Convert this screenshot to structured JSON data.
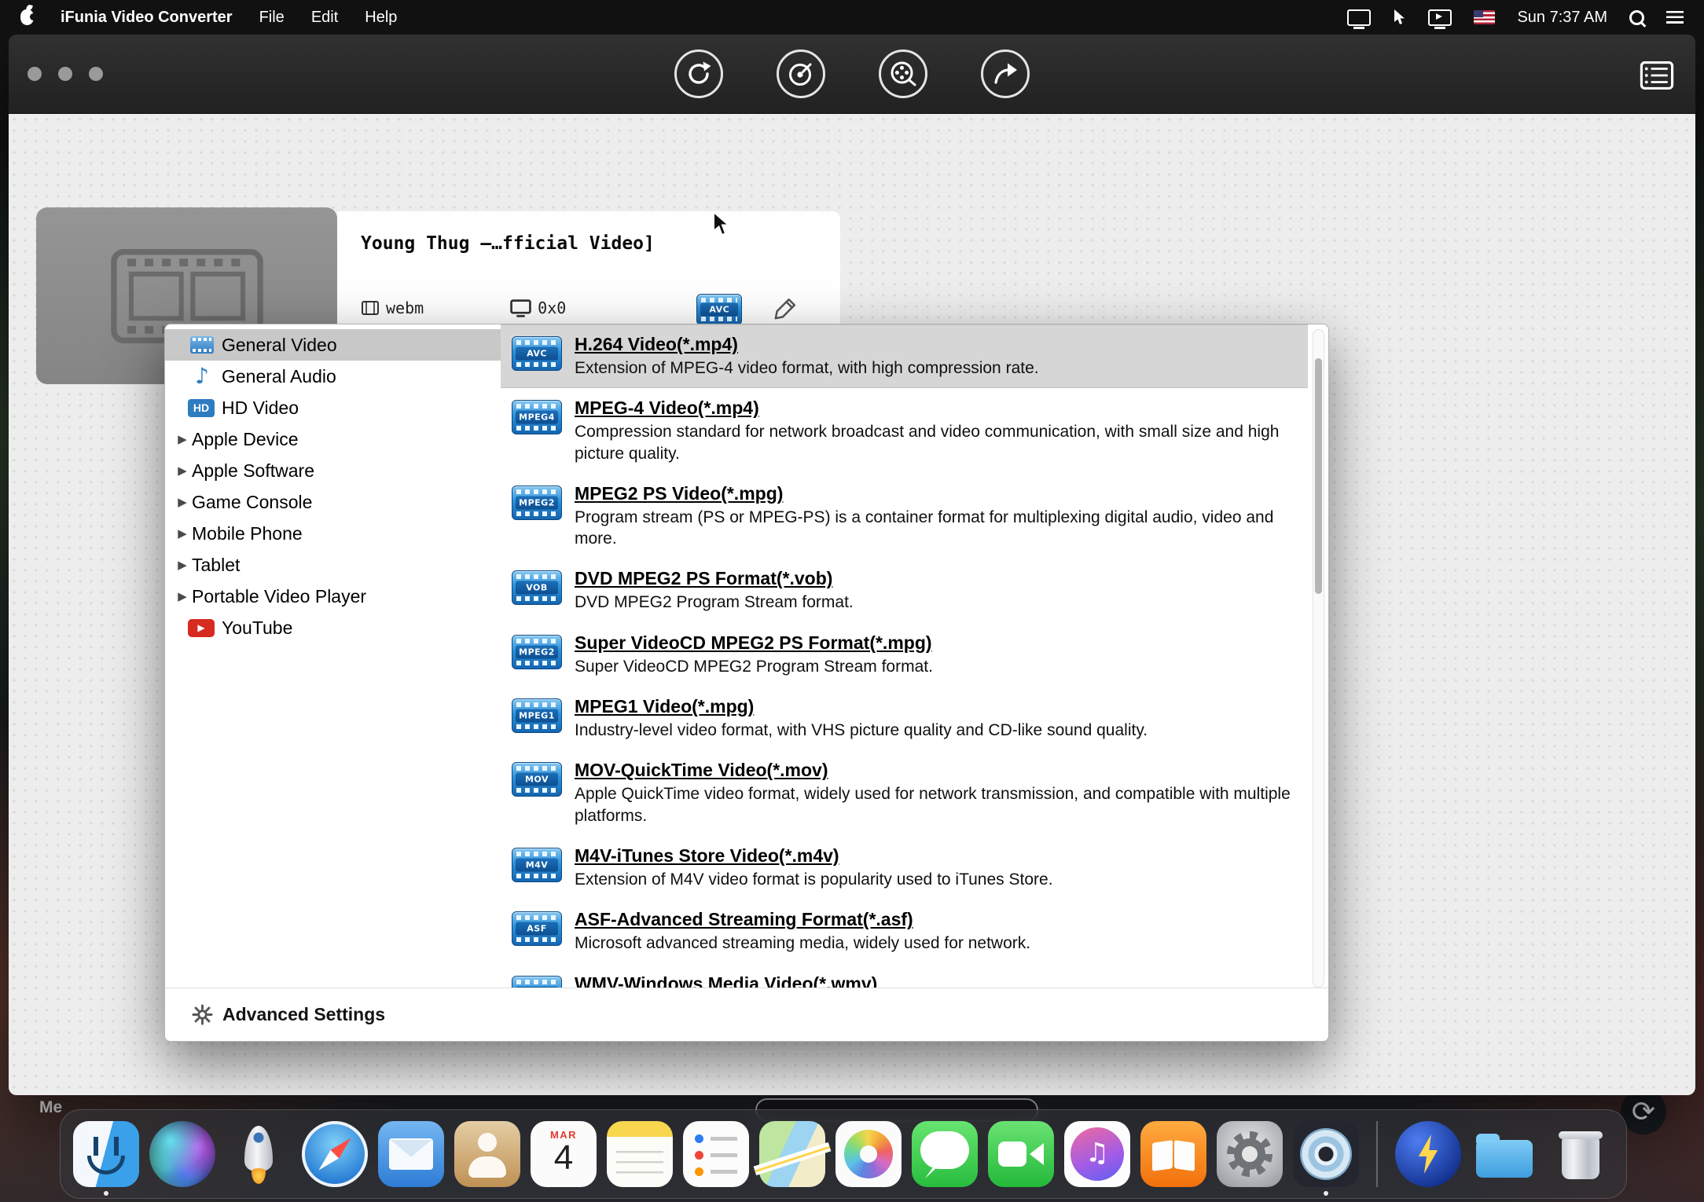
{
  "menu_bar": {
    "app_name": "iFunia Video Converter",
    "menus": [
      "File",
      "Edit",
      "Help"
    ],
    "clock": "Sun 7:37 AM",
    "status_icons": [
      "display-mirroring-icon",
      "remote-cursor-icon",
      "screen-share-icon",
      "us-flag-input-icon",
      "spotlight-icon",
      "notification-center-icon"
    ]
  },
  "colors": {
    "format_badge_blue": "#2a8fd8",
    "selection_gray": "#d6d6d6",
    "sidebar_selection_gray": "#c8c8c8"
  },
  "app_window": {
    "toolbar_icons": [
      "convert-icon",
      "burn-disc-icon",
      "film-reel-icon",
      "share-icon",
      "media-browser-icon"
    ],
    "video_item": {
      "title": "Young Thug —…fficial Video]",
      "container_format": "webm",
      "resolution": "0x0",
      "output_badge": "AVC"
    },
    "popover": {
      "categories": [
        {
          "label": "General Video",
          "icon": "film",
          "selected": true
        },
        {
          "label": "General Audio",
          "icon": "music"
        },
        {
          "label": "HD Video",
          "icon": "hd"
        },
        {
          "label": "Apple Device",
          "expandable": true
        },
        {
          "label": "Apple Software",
          "expandable": true
        },
        {
          "label": "Game Console",
          "expandable": true
        },
        {
          "label": "Mobile Phone",
          "expandable": true
        },
        {
          "label": "Tablet",
          "expandable": true
        },
        {
          "label": "Portable Video Player",
          "expandable": true
        },
        {
          "label": "YouTube",
          "icon": "youtube"
        }
      ],
      "formats": [
        {
          "badge": "AVC",
          "name": "H.264 Video(*.mp4)",
          "desc": "Extension of MPEG-4 video format, with high compression rate.",
          "selected": true
        },
        {
          "badge": "MPEG4",
          "name": "MPEG-4 Video(*.mp4)",
          "desc": "Compression standard for network broadcast and video communication, with small size and high picture quality."
        },
        {
          "badge": "MPEG2",
          "name": "MPEG2 PS Video(*.mpg)",
          "desc": "Program stream (PS or MPEG-PS) is a container format for multiplexing digital audio, video and more."
        },
        {
          "badge": "VOB",
          "name": "DVD MPEG2 PS Format(*.vob)",
          "desc": "DVD MPEG2 Program Stream format."
        },
        {
          "badge": "MPEG2",
          "name": "Super VideoCD MPEG2 PS Format(*.mpg)",
          "desc": "Super VideoCD MPEG2 Program Stream format."
        },
        {
          "badge": "MPEG1",
          "name": "MPEG1 Video(*.mpg)",
          "desc": "Industry-level video format, with VHS picture quality and CD-like sound quality."
        },
        {
          "badge": "MOV",
          "name": "MOV-QuickTime Video(*.mov)",
          "desc": "Apple QuickTime video format, widely used for network transmission, and compatible with multiple platforms."
        },
        {
          "badge": "M4V",
          "name": "M4V-iTunes Store Video(*.m4v)",
          "desc": "Extension of M4V video format is popularity used to iTunes Store."
        },
        {
          "badge": "ASF",
          "name": "ASF-Advanced Streaming Format(*.asf)",
          "desc": "Microsoft advanced streaming media, widely used for network."
        },
        {
          "badge": "WMV",
          "name": "WMV-Windows Media Video(*.wmv)",
          "desc": ""
        }
      ],
      "advanced_settings_label": "Advanced Settings"
    }
  },
  "desktop": {
    "partial_label": "Me"
  },
  "dock": {
    "calendar": {
      "month": "MAR",
      "day": "4"
    },
    "items": [
      {
        "name": "finder",
        "running": true
      },
      {
        "name": "siri"
      },
      {
        "name": "launchpad"
      },
      {
        "name": "safari"
      },
      {
        "name": "mail"
      },
      {
        "name": "contacts"
      },
      {
        "name": "calendar"
      },
      {
        "name": "notes"
      },
      {
        "name": "reminders"
      },
      {
        "name": "maps"
      },
      {
        "name": "photos"
      },
      {
        "name": "messages"
      },
      {
        "name": "facetime"
      },
      {
        "name": "itunes"
      },
      {
        "name": "books"
      },
      {
        "name": "system-preferences"
      },
      {
        "name": "ifunia-video-converter",
        "running": true
      },
      {
        "type": "separator"
      },
      {
        "name": "power-utility"
      },
      {
        "name": "downloads-folder"
      },
      {
        "name": "trash"
      }
    ]
  }
}
